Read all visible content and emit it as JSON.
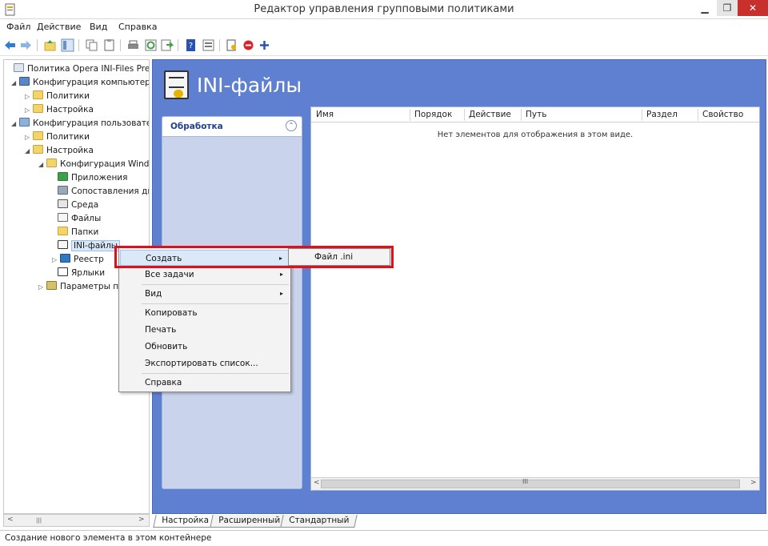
{
  "window": {
    "title": "Редактор управления групповыми политиками",
    "buttons": {
      "minimize": "▁",
      "maximize": "❐",
      "close": "✕"
    }
  },
  "menubar": [
    "Файл",
    "Действие",
    "Вид",
    "Справка"
  ],
  "toolbar": {
    "icons": [
      "back-icon",
      "forward-icon",
      "up-folder-icon",
      "show-hide-tree-icon",
      "copy-icon",
      "paste-icon",
      "print-icon",
      "refresh-icon",
      "export-icon",
      "help-icon",
      "properties-icon",
      "new-item-icon",
      "stop-icon",
      "add-icon"
    ]
  },
  "tree": {
    "nodes": [
      {
        "label": "Политика Opera INI-Files Prefs",
        "icon": "policy",
        "expander": ""
      },
      {
        "label": "Конфигурация компьютера",
        "icon": "comp",
        "expander": "◢"
      },
      {
        "label": "Политики",
        "icon": "folder",
        "expander": "▷"
      },
      {
        "label": "Настройка",
        "icon": "folder",
        "expander": "▷"
      },
      {
        "label": "Конфигурация пользователя",
        "icon": "user",
        "expander": "◢"
      },
      {
        "label": "Политики",
        "icon": "folder",
        "expander": "▷"
      },
      {
        "label": "Настройка",
        "icon": "folder",
        "expander": "◢"
      },
      {
        "label": "Конфигурация Windows",
        "icon": "folder",
        "expander": "◢"
      },
      {
        "label": "Приложения",
        "icon": "app",
        "expander": ""
      },
      {
        "label": "Сопоставления дисков",
        "icon": "map",
        "expander": ""
      },
      {
        "label": "Среда",
        "icon": "env",
        "expander": ""
      },
      {
        "label": "Файлы",
        "icon": "file",
        "expander": ""
      },
      {
        "label": "Папки",
        "icon": "folder",
        "expander": ""
      },
      {
        "label": "INI-файлы",
        "icon": "ini",
        "expander": "",
        "selected": true
      },
      {
        "label": "Реестр",
        "icon": "reg",
        "expander": "▷"
      },
      {
        "label": "Ярлыки",
        "icon": "short",
        "expander": ""
      },
      {
        "label": "Параметры панели управления",
        "icon": "ctrl",
        "expander": "▷"
      }
    ],
    "scroll": {
      "left": "<",
      "grip": "|||",
      "right": ">"
    }
  },
  "main": {
    "title": "INI-файлы",
    "actions_panel": {
      "title": "Обработка",
      "collapse_glyph": "⌃"
    },
    "list": {
      "columns": [
        "Имя",
        "Порядок",
        "Действие",
        "Путь",
        "Раздел",
        "Свойство"
      ],
      "empty_message": "Нет элементов для отображения в этом виде.",
      "scroll": {
        "left": "<",
        "grip": "III",
        "right": ">"
      }
    }
  },
  "tabs": [
    "Настройка",
    "Расширенный",
    "Стандартный"
  ],
  "context_menu": {
    "items": [
      {
        "label": "Создать",
        "submenu": true,
        "highlighted": true
      },
      {
        "label": "Все задачи",
        "submenu": true
      },
      {
        "label": "Вид",
        "submenu": true
      },
      {
        "label": "Копировать"
      },
      {
        "label": "Печать"
      },
      {
        "label": "Обновить"
      },
      {
        "label": "Экспортировать список..."
      },
      {
        "label": "Справка"
      }
    ],
    "submenu_arrow": "▸",
    "submenu": {
      "items": [
        "Файл .ini"
      ]
    }
  },
  "status_bar": {
    "text": "Создание нового элемента в этом контейнере"
  },
  "colors": {
    "main_background": "#5f7fd1",
    "actions_panel": "#c9d4ec",
    "highlight_border": "#e0101a",
    "close_button": "#c7302c"
  }
}
